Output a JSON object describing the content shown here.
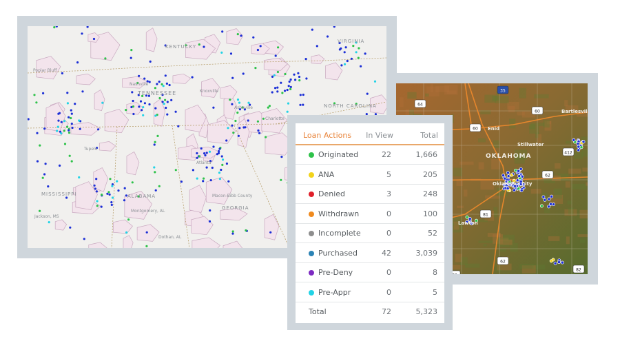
{
  "left_map": {
    "labels": {
      "kentucky": "KENTUCKY",
      "virginia": "VIRGINIA",
      "tennessee": "TENNESSEE",
      "north_carolina": "NORTH\nCAROLINA",
      "mississippi": "MISSISSIPPI",
      "alabama": "ALABAMA",
      "georgia": "GEORGIA",
      "poplar_bluff": "Poplar Bluff",
      "tupelo": "Tupelo",
      "nashville": "Nashville",
      "knoxville": "Knoxville",
      "asheville": "Asheville",
      "charlotte": "Charlotte",
      "atlanta": "Atlanta",
      "jackson": "Jackson, MS",
      "macon": "Macon-Bibb County",
      "montgomery": "Montgomery, AL",
      "dothan": "Dothan, AL"
    }
  },
  "right_map": {
    "labels": {
      "oklahoma": "OKLAHOMA",
      "enid": "Enid",
      "stillwater": "Stillwater",
      "bartlesville": "Bartlesville",
      "oklahoma_city": "Oklahoma City",
      "lawton": "Lawton"
    },
    "shields": [
      "35",
      "64",
      "60",
      "60",
      "412",
      "62",
      "81",
      "62",
      "82",
      "82"
    ]
  },
  "loan_actions": {
    "headers": {
      "label": "Loan Actions",
      "in_view": "In View",
      "total": "Total"
    },
    "rows": [
      {
        "label": "Originated",
        "in_view": "22",
        "total": "1,666",
        "color": "#2ec24a"
      },
      {
        "label": "ANA",
        "in_view": "5",
        "total": "205",
        "color": "#f2d31b"
      },
      {
        "label": "Denied",
        "in_view": "3",
        "total": "248",
        "color": "#e0202a"
      },
      {
        "label": "Withdrawn",
        "in_view": "0",
        "total": "100",
        "color": "#f08a1e"
      },
      {
        "label": "Incomplete",
        "in_view": "0",
        "total": "52",
        "color": "#8e8e8e"
      },
      {
        "label": "Purchased",
        "in_view": "42",
        "total": "3,039",
        "color": "#2b83b5"
      },
      {
        "label": "Pre-Deny",
        "in_view": "0",
        "total": "8",
        "color": "#7d2bc2"
      },
      {
        "label": "Pre-Appr",
        "in_view": "0",
        "total": "5",
        "color": "#22d3e6"
      }
    ],
    "total_row": {
      "label": "Total",
      "in_view": "72",
      "total": "5,323"
    }
  }
}
